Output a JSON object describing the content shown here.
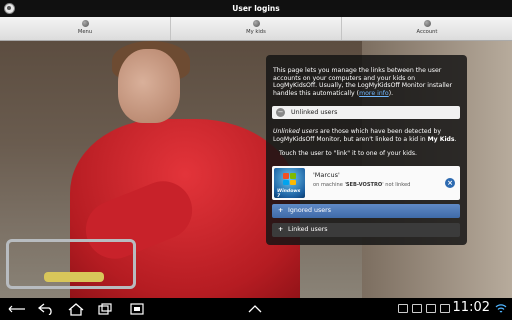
{
  "titlebar": {
    "title": "User logins"
  },
  "nav": {
    "tabs": [
      {
        "label": "Menu"
      },
      {
        "label": "My kids"
      },
      {
        "label": "Account"
      }
    ]
  },
  "panel": {
    "intro_pre": "This page lets you manage the links between the user accounts on your computers and your kids on LogMyKidsOff. Usually, the LogMyKidsOff Monitor installer handles this automatically (",
    "intro_link": "more info",
    "intro_post": ").",
    "unlinked_header": "Unlinked users",
    "desc_em": "Unlinked users",
    "desc_mid": " are those which have been detected by LogMyKidsOff Monitor, but aren't linked to a kid in ",
    "desc_strong": "My Kids",
    "desc_end": ".",
    "touch_hint": "Touch the user to \"link\" it to one of your kids.",
    "user": {
      "name": "'Marcus'",
      "machine_pre": "on machine '",
      "machine": "SEB-VOSTRO",
      "machine_post": "' not linked",
      "os_text": "Windows 7"
    },
    "ignored_label": "Ignored users",
    "linked_label": "Linked users"
  },
  "sysbar": {
    "time": "11:02"
  }
}
